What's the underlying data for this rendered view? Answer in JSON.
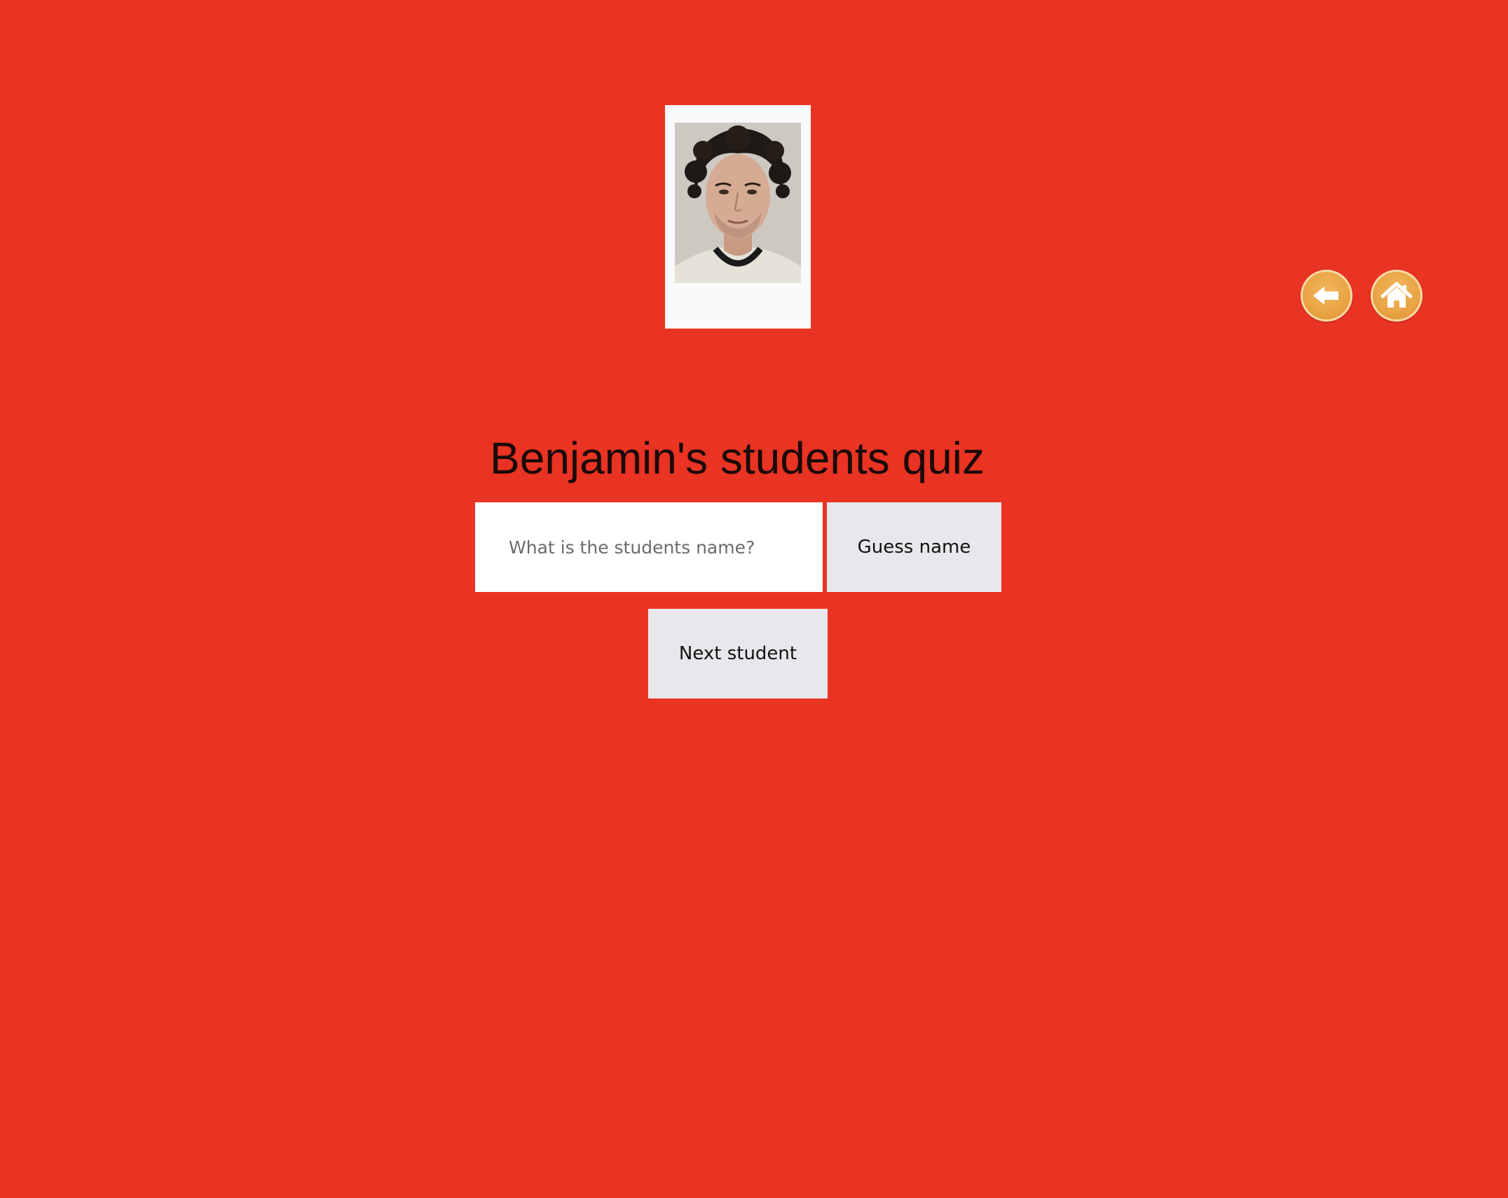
{
  "quiz": {
    "title": "Benjamin's students quiz",
    "input_placeholder": "What is the students name?",
    "input_value": "",
    "guess_label": "Guess name",
    "next_label": "Next student"
  },
  "nav": {
    "back_icon": "back-arrow-icon",
    "home_icon": "home-icon"
  },
  "colors": {
    "background": "#e93323",
    "button_bg": "#e8e8ec",
    "nav_button": "#e9a445"
  }
}
